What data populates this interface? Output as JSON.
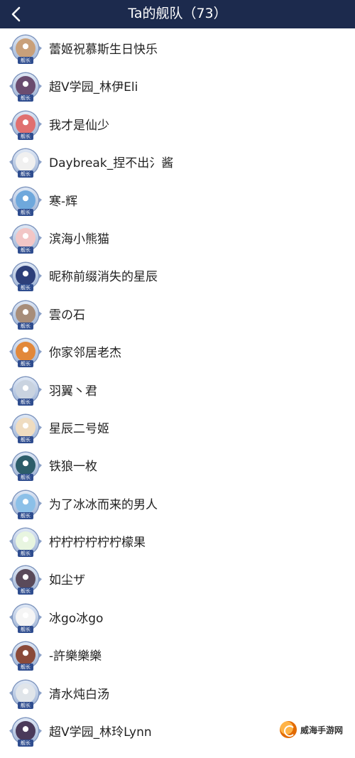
{
  "header": {
    "title": "Ta的舰队（73）",
    "back_icon": "chevron-left-icon"
  },
  "badge_label": "舰长",
  "members": [
    {
      "name": "蕾姬祝慕斯生日快乐",
      "color": "#c9a07a"
    },
    {
      "name": "超V学园_林伊Eli",
      "color": "#6a4c6f"
    },
    {
      "name": "我才是仙少",
      "color": "#e07070"
    },
    {
      "name": "Daybreak_捏不出氵酱",
      "color": "#f0f0f0"
    },
    {
      "name": "寒-辉",
      "color": "#6fa8dc"
    },
    {
      "name": "滨海小熊猫",
      "color": "#f2c6c6"
    },
    {
      "name": "昵称前缀消失的星辰",
      "color": "#2d3f7a"
    },
    {
      "name": "雲の石",
      "color": "#a78d7a"
    },
    {
      "name": "你家邻居老杰",
      "color": "#e2883a"
    },
    {
      "name": "羽翼丶君",
      "color": "#c9d3e0"
    },
    {
      "name": "星辰二号姬",
      "color": "#efdcc0"
    },
    {
      "name": "铁狼一枚",
      "color": "#2d5d6a"
    },
    {
      "name": "为了冰冰而来的男人",
      "color": "#8cc0e8"
    },
    {
      "name": "柠柠柠柠柠柠檬果",
      "color": "#e8f5e0"
    },
    {
      "name": "如尘ザ",
      "color": "#5a4a5a"
    },
    {
      "name": "冰go冰go",
      "color": "#f5f5f5"
    },
    {
      "name": "-許樂樂樂",
      "color": "#8a4a3a"
    },
    {
      "name": "清水炖白汤",
      "color": "#e0e5ea"
    },
    {
      "name": "超V学园_林玲Lynn",
      "color": "#4a3a5a"
    }
  ],
  "watermark": {
    "text": "威海手游网"
  }
}
